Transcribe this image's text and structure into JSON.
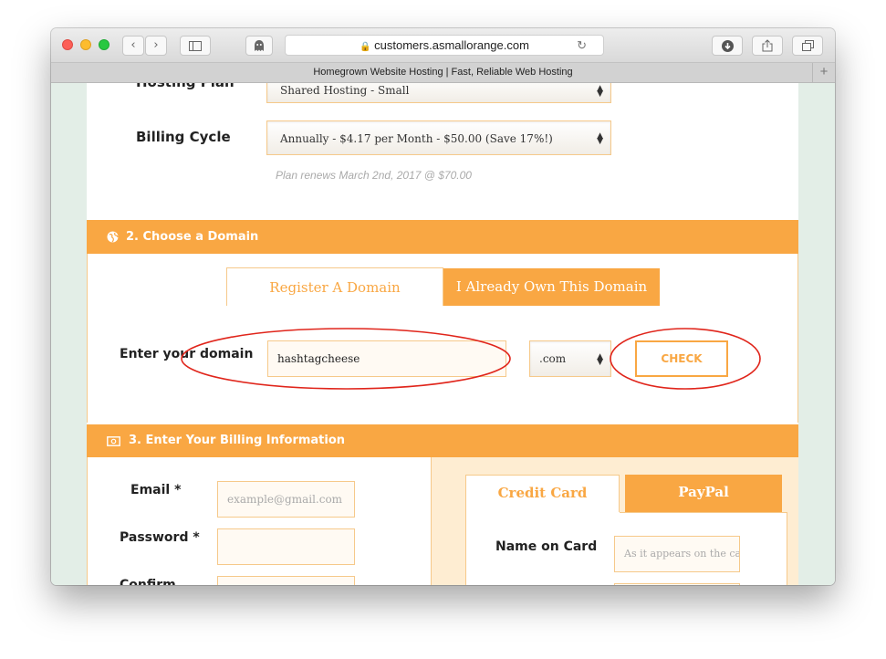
{
  "browser": {
    "url": "customers.asmallorange.com",
    "tab_title": "Homegrown Website Hosting | Fast, Reliable Web Hosting"
  },
  "plan": {
    "hosting_label": "Hosting Plan",
    "hosting_value": "Shared Hosting - Small",
    "billing_label": "Billing Cycle",
    "billing_value": "Annually - $4.17 per Month - $50.00 (Save 17%!)",
    "renew_note": "Plan renews March 2nd, 2017 @ $70.00"
  },
  "domain": {
    "section_title": "2. Choose a Domain",
    "tab_register": "Register A Domain",
    "tab_own": "I Already Own This Domain",
    "enter_label": "Enter your domain",
    "domain_value": "hashtagcheese",
    "tld_value": ".com",
    "check_label": "CHECK"
  },
  "billing": {
    "section_title": "3. Enter Your Billing Information",
    "email_label": "Email *",
    "email_placeholder": "example@gmail.com",
    "password_label": "Password *",
    "confirm_label": "Confirm",
    "pay_tab_card": "Credit Card",
    "pay_tab_paypal": "PayPal",
    "name_on_card_label": "Name on Card",
    "name_on_card_placeholder": "As it appears on the card"
  },
  "colors": {
    "accent": "#f9a743",
    "annotation": "#e0251b"
  }
}
